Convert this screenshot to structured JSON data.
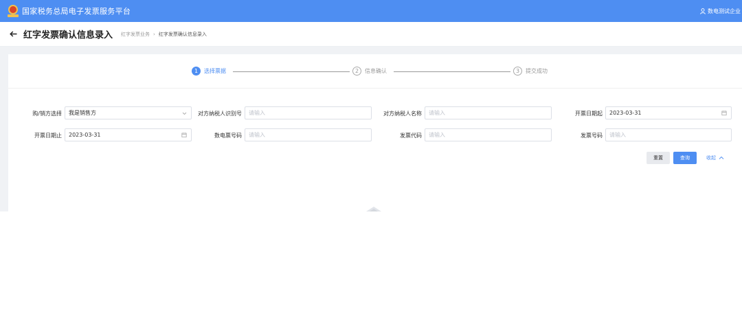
{
  "app": {
    "title": "国家税务总局电子发票服务平台",
    "user": "数电测试企业"
  },
  "page": {
    "title": "红字发票确认信息录入",
    "back_icon": "arrow-left-icon"
  },
  "breadcrumb": {
    "items": [
      "红字发票业务",
      "红字发票确认信息录入"
    ],
    "separator": "›"
  },
  "steps": [
    {
      "num": "1",
      "label": "选择票据"
    },
    {
      "num": "2",
      "label": "信息确认"
    },
    {
      "num": "3",
      "label": "提交成功"
    }
  ],
  "form": {
    "buyer_seller": {
      "label": "购/销方选择",
      "value": "我是销售方"
    },
    "counter_tax_id": {
      "label": "对方纳税人识别号",
      "placeholder": "请输入"
    },
    "counter_name": {
      "label": "对方纳税人名称",
      "placeholder": "请输入"
    },
    "date_from": {
      "label": "开票日期起",
      "value": "2023-03-31"
    },
    "date_to": {
      "label": "开票日期止",
      "value": "2023-03-31"
    },
    "digital_invoice_no": {
      "label": "数电票号码",
      "placeholder": "请输入"
    },
    "invoice_code": {
      "label": "发票代码",
      "placeholder": "请输入"
    },
    "invoice_no": {
      "label": "发票号码",
      "placeholder": "请输入"
    }
  },
  "actions": {
    "reset": "重置",
    "query": "查询",
    "collapse": "收起"
  },
  "colors": {
    "primary": "#4e8ef2",
    "page_bg": "#f0f2f5"
  }
}
